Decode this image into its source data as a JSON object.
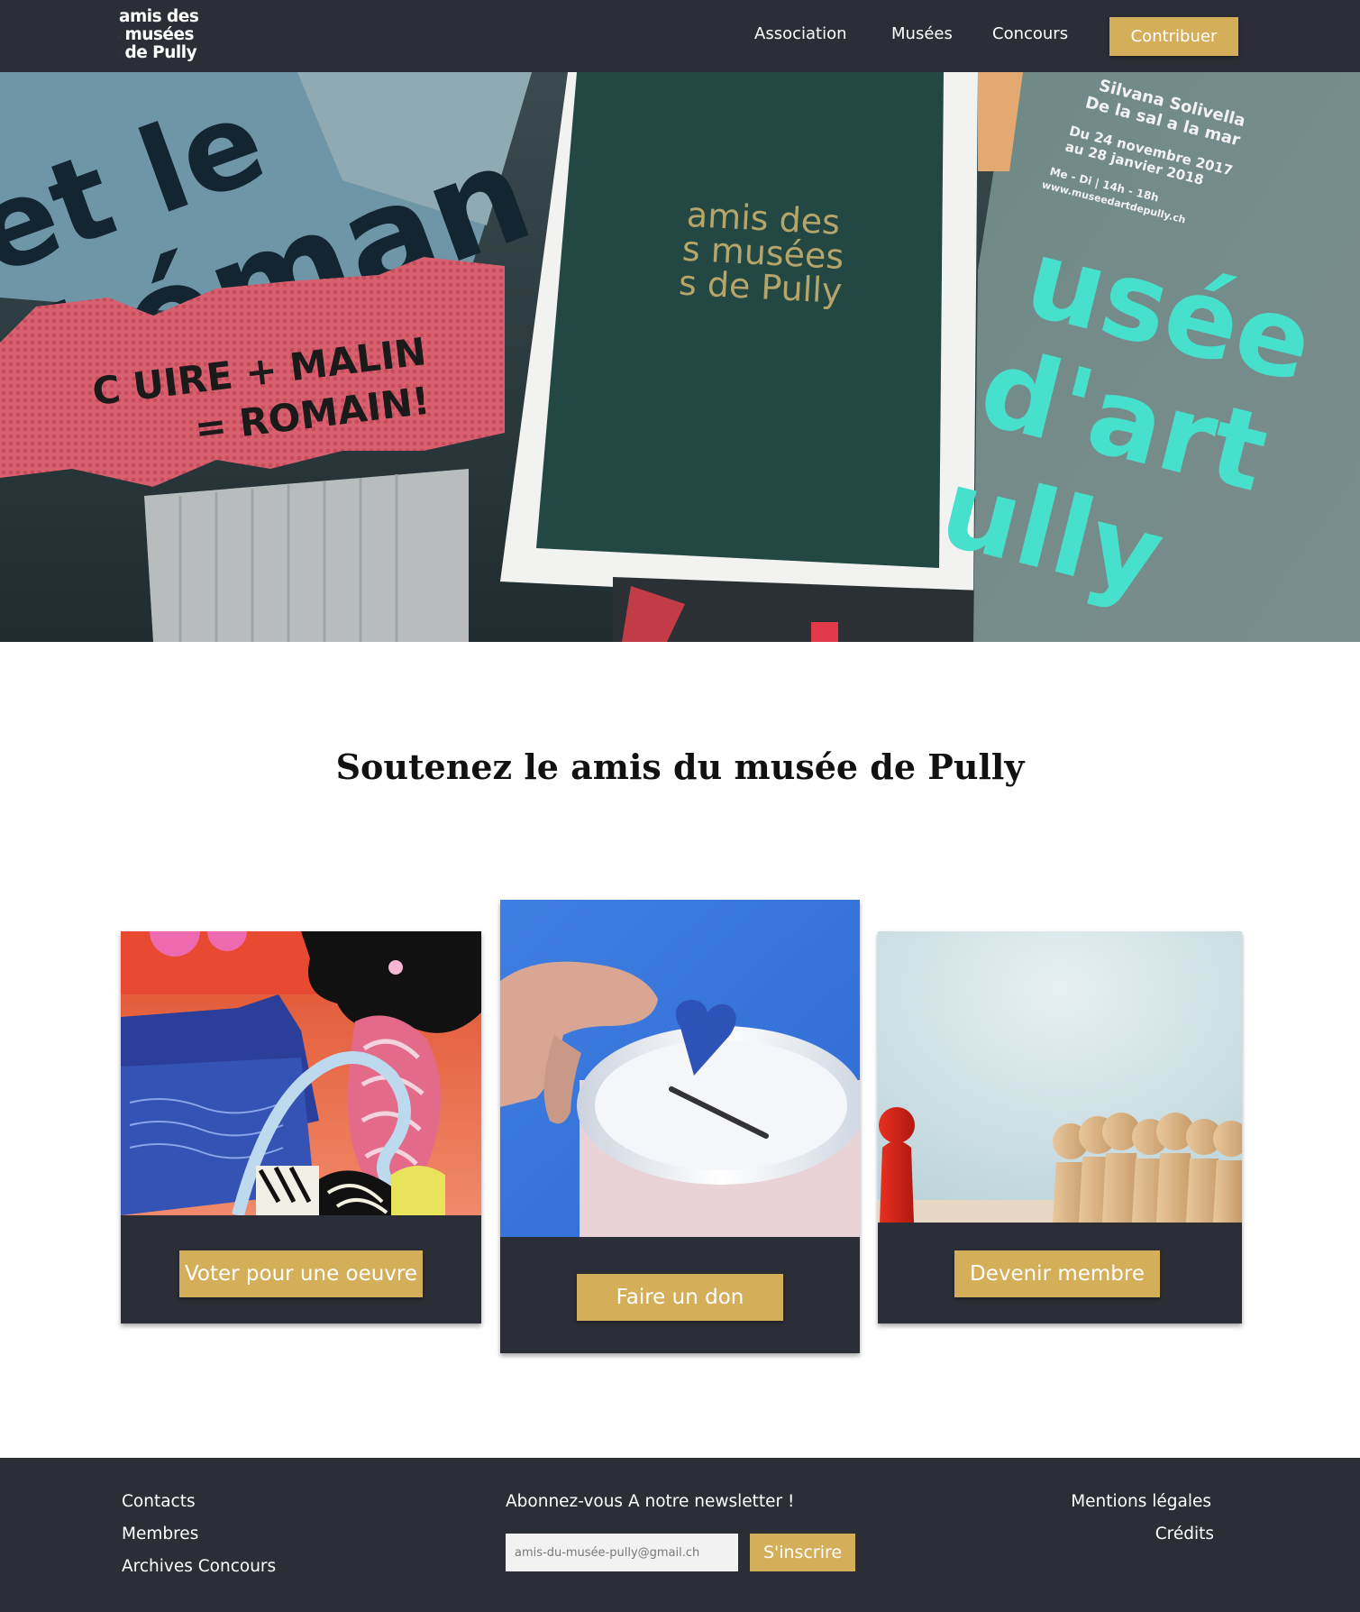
{
  "header": {
    "logo_lines": [
      "amis des",
      "musées",
      "de Pully"
    ],
    "nav": [
      "Association",
      "Musées",
      "Concours"
    ],
    "cta_label": "Contribuer"
  },
  "hero": {
    "image_text": {
      "card": [
        "amis des",
        "s musées",
        "s de Pully"
      ],
      "poster_left": [
        "et le",
        "Léman"
      ],
      "banner": [
        "C  UIRE + MALIN",
        "= ROMAIN!"
      ],
      "poster_right_header": [
        "Silvana Solivella",
        "De la sal a la mar",
        "Du 24 novembre 2017",
        "au 28 janvier 2018",
        "Me - Di | 14h - 18h",
        "www.museedartdepully.ch"
      ],
      "poster_right_big": [
        "usée",
        "d'art",
        "ully"
      ]
    }
  },
  "main": {
    "title": "Soutenez le amis du musée de Pully",
    "cards": [
      {
        "label": "Voter pour une oeuvre",
        "image": "artwork-collage"
      },
      {
        "label": "Faire un don",
        "image": "donation-box"
      },
      {
        "label": "Devenir membre",
        "image": "wooden-figures"
      }
    ]
  },
  "footer": {
    "left_links": [
      "Contacts",
      "Membres",
      "Archives Concours"
    ],
    "newsletter_title": "Abonnez-vous A notre newsletter !",
    "newsletter_placeholder": "amis-du-musée-pully@gmail.ch",
    "newsletter_button": "S'inscrire",
    "right_links": [
      "Mentions légales",
      "Crédits"
    ]
  },
  "colors": {
    "dark": "#2c2e37",
    "gold": "#d5ae5a"
  }
}
